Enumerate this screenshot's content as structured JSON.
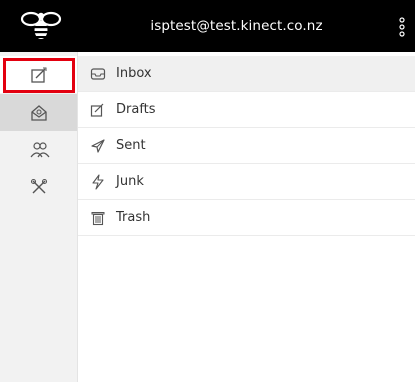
{
  "header": {
    "account_email": "isptest@test.kinect.co.nz",
    "logo_icon": "bee-icon",
    "menu_icon": "kebab-menu-icon",
    "background": "#000000"
  },
  "rail": {
    "items": [
      {
        "name": "compose",
        "icon": "compose-icon"
      },
      {
        "name": "mail",
        "icon": "mail-envelope-icon"
      },
      {
        "name": "contacts",
        "icon": "contacts-icon"
      },
      {
        "name": "settings",
        "icon": "tools-icon"
      }
    ],
    "highlight_color": "#e3000f"
  },
  "folders": [
    {
      "label": "Inbox",
      "icon": "inbox-icon",
      "selected": true
    },
    {
      "label": "Drafts",
      "icon": "drafts-icon"
    },
    {
      "label": "Sent",
      "icon": "sent-icon"
    },
    {
      "label": "Junk",
      "icon": "junk-icon"
    },
    {
      "label": "Trash",
      "icon": "trash-icon"
    }
  ]
}
